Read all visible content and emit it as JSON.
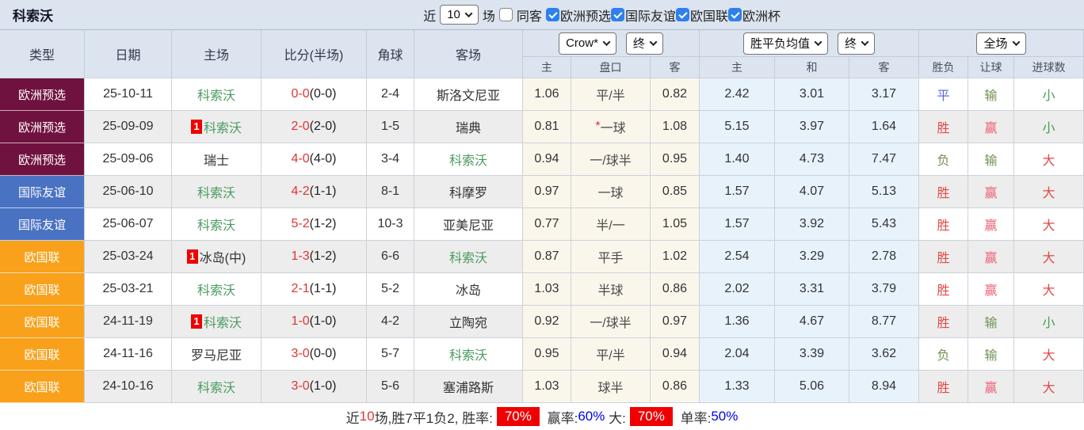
{
  "topbar": {
    "title": "科索沃",
    "recent_label": "近",
    "recent_count": "10",
    "matches_label": "场",
    "same_away_label": "同客",
    "same_away_checked": false,
    "filters": [
      {
        "label": "欧洲预选",
        "checked": true
      },
      {
        "label": "国际友谊",
        "checked": true
      },
      {
        "label": "欧国联",
        "checked": true
      },
      {
        "label": "欧洲杯",
        "checked": true
      }
    ]
  },
  "table": {
    "columns": [
      "类型",
      "日期",
      "主场",
      "比分(半场)",
      "角球",
      "客场"
    ],
    "sections": {
      "ah": {
        "company": "Crow*",
        "time": "终"
      },
      "eu": {
        "company": "胜平负均值",
        "time": "终"
      },
      "result": {
        "scope": "全场"
      }
    },
    "sub_columns": [
      "主",
      "盘口",
      "客",
      "主",
      "和",
      "客",
      "胜负",
      "让球",
      "进球数"
    ],
    "rows": [
      {
        "type": "欧洲预选",
        "type_color": "type_maroon",
        "date": "25-10-11",
        "home": {
          "name": "科索沃",
          "green": true,
          "badge": ""
        },
        "score_ft": "0-0",
        "score_ht": "(0-0)",
        "corner": "2-4",
        "away": {
          "name": "斯洛文尼亚",
          "green": false
        },
        "ah": {
          "home": "1.06",
          "star": false,
          "line": "平/半",
          "away": "0.82"
        },
        "eu": {
          "home": "2.42",
          "draw": "3.01",
          "away": "3.17"
        },
        "result": {
          "wdl": {
            "text": "平",
            "color": "blue"
          },
          "handicap": {
            "text": "输",
            "color": "olive"
          },
          "goals": {
            "text": "小",
            "color": "green"
          }
        }
      },
      {
        "type": "欧洲预选",
        "type_color": "type_maroon",
        "date": "25-09-09",
        "home": {
          "name": "科索沃",
          "green": true,
          "badge": "1"
        },
        "score_ft": "2-0",
        "score_ht": "(2-0)",
        "corner": "1-5",
        "away": {
          "name": "瑞典",
          "green": false
        },
        "ah": {
          "home": "0.81",
          "star": true,
          "line": "一球",
          "away": "1.08"
        },
        "eu": {
          "home": "5.15",
          "draw": "3.97",
          "away": "1.64"
        },
        "result": {
          "wdl": {
            "text": "胜",
            "color": "red"
          },
          "handicap": {
            "text": "赢",
            "color": "pink"
          },
          "goals": {
            "text": "小",
            "color": "green"
          }
        }
      },
      {
        "type": "欧洲预选",
        "type_color": "type_maroon",
        "date": "25-09-06",
        "home": {
          "name": "瑞士",
          "green": false,
          "badge": ""
        },
        "score_ft": "4-0",
        "score_ht": "(4-0)",
        "corner": "3-4",
        "away": {
          "name": "科索沃",
          "green": true
        },
        "ah": {
          "home": "0.94",
          "star": false,
          "line": "一/球半",
          "away": "0.95"
        },
        "eu": {
          "home": "1.40",
          "draw": "4.73",
          "away": "7.47"
        },
        "result": {
          "wdl": {
            "text": "负",
            "color": "olive"
          },
          "handicap": {
            "text": "输",
            "color": "olive"
          },
          "goals": {
            "text": "大",
            "color": "red"
          }
        }
      },
      {
        "type": "国际友谊",
        "type_color": "type_blue",
        "date": "25-06-10",
        "home": {
          "name": "科索沃",
          "green": true,
          "badge": ""
        },
        "score_ft": "4-2",
        "score_ht": "(1-1)",
        "corner": "8-1",
        "away": {
          "name": "科摩罗",
          "green": false
        },
        "ah": {
          "home": "0.97",
          "star": false,
          "line": "一球",
          "away": "0.85"
        },
        "eu": {
          "home": "1.57",
          "draw": "4.07",
          "away": "5.13"
        },
        "result": {
          "wdl": {
            "text": "胜",
            "color": "red"
          },
          "handicap": {
            "text": "赢",
            "color": "pink"
          },
          "goals": {
            "text": "大",
            "color": "red"
          }
        }
      },
      {
        "type": "国际友谊",
        "type_color": "type_blue",
        "date": "25-06-07",
        "home": {
          "name": "科索沃",
          "green": true,
          "badge": ""
        },
        "score_ft": "5-2",
        "score_ht": "(1-2)",
        "corner": "10-3",
        "away": {
          "name": "亚美尼亚",
          "green": false
        },
        "ah": {
          "home": "0.77",
          "star": false,
          "line": "半/一",
          "away": "1.05"
        },
        "eu": {
          "home": "1.57",
          "draw": "3.92",
          "away": "5.43"
        },
        "result": {
          "wdl": {
            "text": "胜",
            "color": "red"
          },
          "handicap": {
            "text": "赢",
            "color": "pink"
          },
          "goals": {
            "text": "大",
            "color": "red"
          }
        }
      },
      {
        "type": "欧国联",
        "type_color": "type_orange",
        "date": "25-03-24",
        "home": {
          "name": "冰岛(中)",
          "green": false,
          "badge": "1"
        },
        "score_ft": "1-3",
        "score_ht": "(1-2)",
        "corner": "6-6",
        "away": {
          "name": "科索沃",
          "green": true
        },
        "ah": {
          "home": "0.87",
          "star": false,
          "line": "平手",
          "away": "1.02"
        },
        "eu": {
          "home": "2.54",
          "draw": "3.29",
          "away": "2.78"
        },
        "result": {
          "wdl": {
            "text": "胜",
            "color": "red"
          },
          "handicap": {
            "text": "赢",
            "color": "pink"
          },
          "goals": {
            "text": "大",
            "color": "red"
          }
        }
      },
      {
        "type": "欧国联",
        "type_color": "type_orange",
        "date": "25-03-21",
        "home": {
          "name": "科索沃",
          "green": true,
          "badge": ""
        },
        "score_ft": "2-1",
        "score_ht": "(1-1)",
        "corner": "5-2",
        "away": {
          "name": "冰岛",
          "green": false
        },
        "ah": {
          "home": "1.03",
          "star": false,
          "line": "半球",
          "away": "0.86"
        },
        "eu": {
          "home": "2.02",
          "draw": "3.31",
          "away": "3.79"
        },
        "result": {
          "wdl": {
            "text": "胜",
            "color": "red"
          },
          "handicap": {
            "text": "赢",
            "color": "pink"
          },
          "goals": {
            "text": "大",
            "color": "red"
          }
        }
      },
      {
        "type": "欧国联",
        "type_color": "type_orange",
        "date": "24-11-19",
        "home": {
          "name": "科索沃",
          "green": true,
          "badge": "1"
        },
        "score_ft": "1-0",
        "score_ht": "(1-0)",
        "corner": "4-2",
        "away": {
          "name": "立陶宛",
          "green": false
        },
        "ah": {
          "home": "0.92",
          "star": false,
          "line": "一/球半",
          "away": "0.97"
        },
        "eu": {
          "home": "1.36",
          "draw": "4.67",
          "away": "8.77"
        },
        "result": {
          "wdl": {
            "text": "胜",
            "color": "red"
          },
          "handicap": {
            "text": "输",
            "color": "olive"
          },
          "goals": {
            "text": "小",
            "color": "green"
          }
        }
      },
      {
        "type": "欧国联",
        "type_color": "type_orange",
        "date": "24-11-16",
        "home": {
          "name": "罗马尼亚",
          "green": false,
          "badge": ""
        },
        "score_ft": "3-0",
        "score_ht": "(0-0)",
        "corner": "5-7",
        "away": {
          "name": "科索沃",
          "green": true
        },
        "ah": {
          "home": "0.95",
          "star": false,
          "line": "平/半",
          "away": "0.94"
        },
        "eu": {
          "home": "2.04",
          "draw": "3.39",
          "away": "3.62"
        },
        "result": {
          "wdl": {
            "text": "负",
            "color": "olive"
          },
          "handicap": {
            "text": "输",
            "color": "olive"
          },
          "goals": {
            "text": "大",
            "color": "red"
          }
        }
      },
      {
        "type": "欧国联",
        "type_color": "type_orange",
        "date": "24-10-16",
        "home": {
          "name": "科索沃",
          "green": true,
          "badge": ""
        },
        "score_ft": "3-0",
        "score_ht": "(1-0)",
        "corner": "5-6",
        "away": {
          "name": "塞浦路斯",
          "green": false
        },
        "ah": {
          "home": "1.03",
          "star": false,
          "line": "球半",
          "away": "0.86"
        },
        "eu": {
          "home": "1.33",
          "draw": "5.06",
          "away": "8.94"
        },
        "result": {
          "wdl": {
            "text": "胜",
            "color": "red"
          },
          "handicap": {
            "text": "赢",
            "color": "pink"
          },
          "goals": {
            "text": "大",
            "color": "red"
          }
        }
      }
    ]
  },
  "footer": {
    "segments": [
      {
        "text": "近",
        "style": "plain"
      },
      {
        "text": "10",
        "style": "red"
      },
      {
        "text": "场,胜7平1负2, 胜率:",
        "style": "plain"
      },
      {
        "text": "70%",
        "style": "badge"
      },
      {
        "text": " 赢率:",
        "style": "plain"
      },
      {
        "text": "60%",
        "style": "blue"
      },
      {
        "text": " 大:",
        "style": "plain"
      },
      {
        "text": "70%",
        "style": "badge"
      },
      {
        "text": " 单率:",
        "style": "plain"
      },
      {
        "text": "50%",
        "style": "blue"
      }
    ]
  },
  "palette": {
    "red": "#e04a46",
    "pink": "#ee5f78",
    "green": "#4d9b57",
    "olive": "#759155",
    "blue": "#5b6ade",
    "team_green": "#4a9a60",
    "score_red": "#e13333",
    "type_maroon": "#70123f",
    "type_blue": "#4a72c2",
    "type_orange": "#f9a11b"
  }
}
